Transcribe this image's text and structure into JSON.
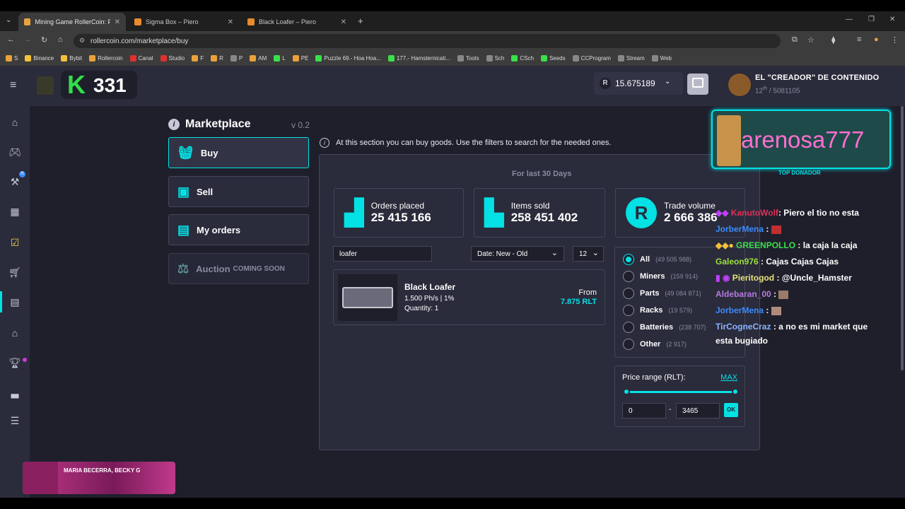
{
  "browser": {
    "tabs": [
      {
        "title": "Mining Game RollerCoin: Play N",
        "active": true
      },
      {
        "title": "Sigma Box – Piero",
        "active": false
      },
      {
        "title": "Black Loafer – Piero",
        "active": false
      }
    ],
    "url": "rollercoin.com/marketplace/buy",
    "bookmarks": [
      "S",
      "Binance",
      "Bybit",
      "Rollercoin",
      "Canal",
      "Studio",
      "F",
      "R",
      "P",
      "AM",
      "L",
      "PE",
      "Puzzle 69.- Hoa Hoa...",
      "177.- Hamsternicati...",
      "Tools",
      "Sch",
      "CSch",
      "Seeds",
      "CCProgram",
      "Stream",
      "Web"
    ]
  },
  "header": {
    "logo_letter": "K",
    "level": "331",
    "balance": "15.675189",
    "balance_icon": "R",
    "user_name": "EL \"CREADOR\" DE CONTENIDO",
    "rank": "12",
    "rank_suffix": "th",
    "rank_total": "/ 5081105"
  },
  "marketplace": {
    "title": "Marketplace",
    "version": "v 0.2",
    "info": "At this section you can buy goods. Use the filters to search for the needed ones.",
    "menu": [
      {
        "label": "Buy",
        "active": true
      },
      {
        "label": "Sell",
        "active": false
      },
      {
        "label": "My orders",
        "active": false
      }
    ],
    "auction": {
      "label": "Auction",
      "soon": "COMING SOON"
    },
    "period": "For last 30 Days",
    "stats": [
      {
        "label": "Orders placed",
        "value": "25 415 166"
      },
      {
        "label": "Items sold",
        "value": "258 451 402"
      },
      {
        "label": "Trade volume",
        "value": "2 666 386"
      }
    ],
    "search_value": "loafer",
    "sort": "Date: New - Old",
    "per_page": "12",
    "item": {
      "name": "Black Loafer",
      "power": "1.500 Ph/s | 1%",
      "quantity": "Quantity: 1",
      "from_label": "From",
      "price": "7.875 RLT"
    },
    "categories": [
      {
        "label": "All",
        "count": "(49 505 988)",
        "selected": true
      },
      {
        "label": "Miners",
        "count": "(159 914)",
        "selected": false
      },
      {
        "label": "Parts",
        "count": "(49 084 871)",
        "selected": false
      },
      {
        "label": "Racks",
        "count": "(19 579)",
        "selected": false
      },
      {
        "label": "Batteries",
        "count": "(238 707)",
        "selected": false
      },
      {
        "label": "Other",
        "count": "(2 917)",
        "selected": false
      }
    ],
    "price_range": {
      "label": "Price range (RLT):",
      "max_label": "MAX",
      "min": "0",
      "max": "3465",
      "ok": "OK"
    }
  },
  "overlay": {
    "donor_name": "arenosa777",
    "donor_label": "TOP DONADOR",
    "chat": [
      {
        "user": "KanutoWolf",
        "user_color": "#e0305a",
        "text": ": Piero el tio no esta"
      },
      {
        "user": "JorberMena",
        "user_color": "#3b8cff",
        "text": ":"
      },
      {
        "user": "GREENPOLLO",
        "user_color": "#39e04a",
        "text": ": la caja la caja"
      },
      {
        "user": "Galeon976",
        "user_color": "#9be03a",
        "text": ": Cajas Cajas Cajas"
      },
      {
        "user": "Pieritogod",
        "user_color": "#e8e27a",
        "text": ": @Uncle_Hamster"
      },
      {
        "user": "Aldebaran_00",
        "user_color": "#b57be0",
        "text": ":"
      },
      {
        "user": "JorberMena",
        "user_color": "#3b8cff",
        "text": ":"
      },
      {
        "user": "TirCogneCraz",
        "user_color": "#8ab4ff",
        "text": ": a no es mi market que"
      },
      {
        "user": "",
        "user_color": "#fff",
        "text": "esta bugiado"
      }
    ],
    "music": "MARIA BECERRA, BECKY G"
  }
}
